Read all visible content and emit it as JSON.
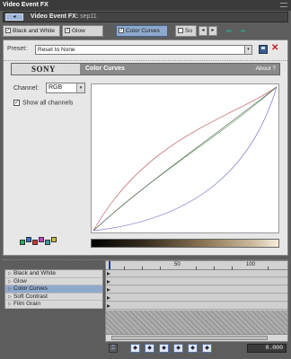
{
  "window": {
    "title": "Video Event FX"
  },
  "event": {
    "prefix": "Video Event FX:",
    "name": "sep11"
  },
  "chain": {
    "items": [
      {
        "label": "Black and White",
        "checked": true
      },
      {
        "label": "Glow",
        "checked": true
      },
      {
        "label": "Color Curves",
        "checked": true,
        "selected": true
      },
      {
        "label": "So",
        "checked": false
      }
    ],
    "nav_prev": "◂",
    "nav_next": "▸"
  },
  "preset": {
    "label": "Preset:",
    "value": "Reset to None",
    "dropdown": "▾"
  },
  "plugin": {
    "vendor": "SONY",
    "name": "Color Curves",
    "about": "About ?"
  },
  "channel": {
    "label": "Channel:",
    "value": "RGB",
    "dropdown": "▾"
  },
  "show_all": {
    "label": "Show all channels",
    "checked": "✓"
  },
  "curves": {
    "colors": {
      "red": "#c87878",
      "green": "#78b878",
      "blue": "#8484d0",
      "rgb": "#333333"
    }
  },
  "fx_list": [
    {
      "label": "Black and White"
    },
    {
      "label": "Glow"
    },
    {
      "label": "Color Curves",
      "selected": true
    },
    {
      "label": "Soft Contrast"
    },
    {
      "label": "Film Grain"
    }
  ],
  "ruler": {
    "marks": [
      "50",
      "100"
    ]
  },
  "keyframe_buttons": [
    "◆",
    "◆",
    "◆",
    "◆",
    "◆",
    "◆"
  ],
  "timecode": "0.000"
}
